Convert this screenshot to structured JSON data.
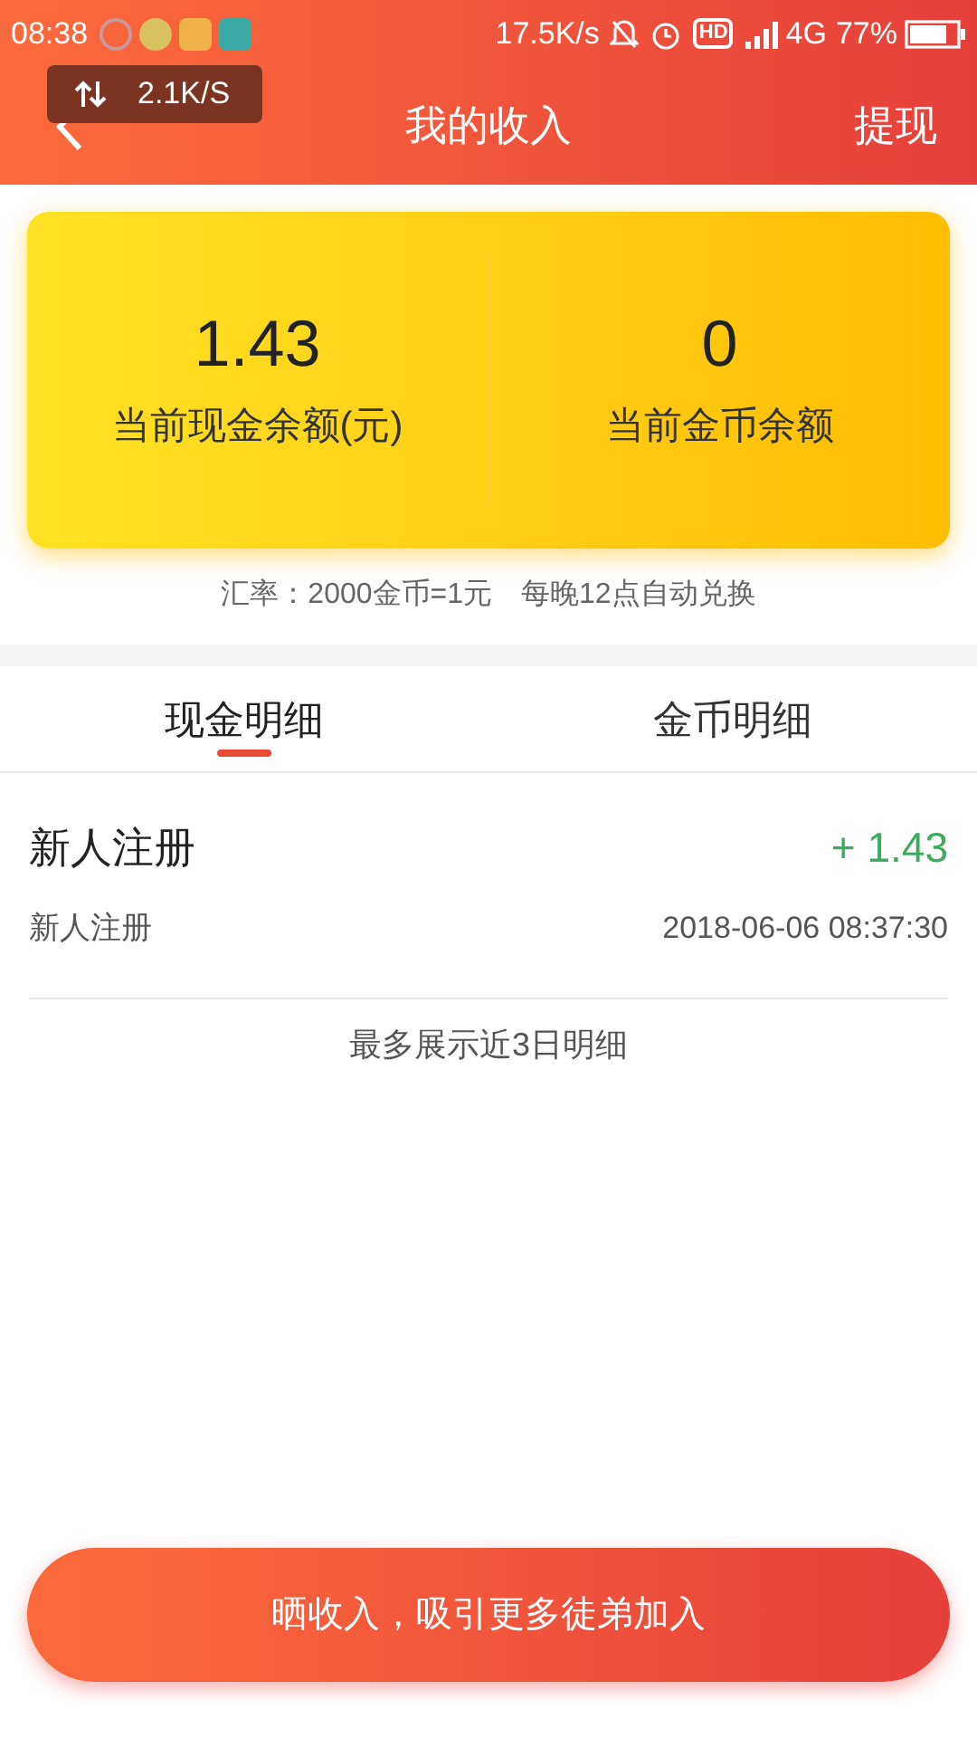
{
  "status_bar": {
    "time": "08:38",
    "speed": "17.5K/s",
    "hd": "HD",
    "network": "4G",
    "battery": "77%"
  },
  "speed_overlay": {
    "text": "2.1K/S"
  },
  "header": {
    "title": "我的收入",
    "action": "提现"
  },
  "balances": [
    {
      "value": "1.43",
      "label": "当前现金余额(元)"
    },
    {
      "value": "0",
      "label": "当前金币余额"
    }
  ],
  "note": "汇率：2000金币=1元　每晚12点自动兑换",
  "tabs": [
    {
      "label": "现金明细",
      "selected": true
    },
    {
      "label": "金币明细",
      "selected": false
    }
  ],
  "records": [
    {
      "title": "新人注册",
      "amount": "+ 1.43",
      "subtitle": "新人注册",
      "time": "2018-06-06 08:37:30"
    }
  ],
  "footer_note": "最多展示近3日明细",
  "share_button": "晒收入，吸引更多徒弟加入"
}
